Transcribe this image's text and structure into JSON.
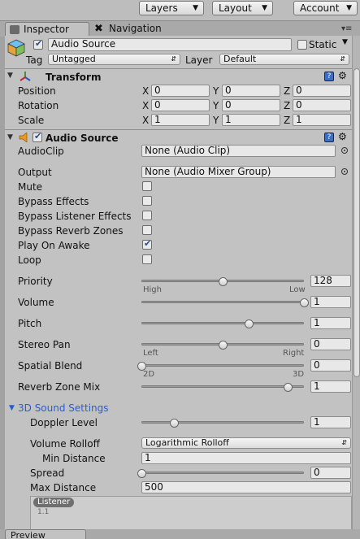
{
  "toolbar": {
    "layers": "Layers",
    "layout": "Layout",
    "account": "Account"
  },
  "tabs": {
    "inspector": "Inspector",
    "navigation": "Navigation"
  },
  "object": {
    "name": "Audio Source",
    "static_label": "Static",
    "tag_label": "Tag",
    "tag_value": "Untagged",
    "layer_label": "Layer",
    "layer_value": "Default"
  },
  "transform": {
    "title": "Transform",
    "position": {
      "label": "Position",
      "x": "0",
      "y": "0",
      "z": "0"
    },
    "rotation": {
      "label": "Rotation",
      "x": "0",
      "y": "0",
      "z": "0"
    },
    "scale": {
      "label": "Scale",
      "x": "1",
      "y": "1",
      "z": "1"
    },
    "axis": {
      "x": "X",
      "y": "Y",
      "z": "Z"
    }
  },
  "audio": {
    "title": "Audio Source",
    "audioclip": {
      "label": "AudioClip",
      "value": "None (Audio Clip)"
    },
    "output": {
      "label": "Output",
      "value": "None (Audio Mixer Group)"
    },
    "mute": {
      "label": "Mute",
      "checked": false
    },
    "bypass_effects": {
      "label": "Bypass Effects",
      "checked": false
    },
    "bypass_listener": {
      "label": "Bypass Listener Effects",
      "checked": false
    },
    "bypass_reverb": {
      "label": "Bypass Reverb Zones",
      "checked": false
    },
    "play_on_awake": {
      "label": "Play On Awake",
      "checked": true
    },
    "loop": {
      "label": "Loop",
      "checked": false
    },
    "priority": {
      "label": "Priority",
      "value": "128",
      "level": 0.5,
      "low_hint": "High",
      "high_hint": "Low"
    },
    "volume": {
      "label": "Volume",
      "value": "1",
      "level": 1.0
    },
    "pitch": {
      "label": "Pitch",
      "value": "1",
      "level": 0.66
    },
    "stereo_pan": {
      "label": "Stereo Pan",
      "value": "0",
      "level": 0.5,
      "low_hint": "Left",
      "high_hint": "Right"
    },
    "spatial_blend": {
      "label": "Spatial Blend",
      "value": "0",
      "level": 0.0,
      "low_hint": "2D",
      "high_hint": "3D"
    },
    "reverb_zone_mix": {
      "label": "Reverb Zone Mix",
      "value": "1",
      "level": 0.9
    }
  },
  "sound3d": {
    "title": "3D Sound Settings",
    "doppler": {
      "label": "Doppler Level",
      "value": "1",
      "level": 0.2
    },
    "rolloff": {
      "label": "Volume Rolloff",
      "value": "Logarithmic Rolloff"
    },
    "min_distance": {
      "label": "Min Distance",
      "value": "1"
    },
    "spread": {
      "label": "Spread",
      "value": "0",
      "level": 0.0
    },
    "max_distance": {
      "label": "Max Distance",
      "value": "500"
    },
    "graph": {
      "listener": "Listener",
      "y_tick": "1.1"
    }
  },
  "preview": {
    "label": "Preview"
  },
  "colors": {
    "accent": "#2a5bd7",
    "panel": "#c2c2c2"
  }
}
